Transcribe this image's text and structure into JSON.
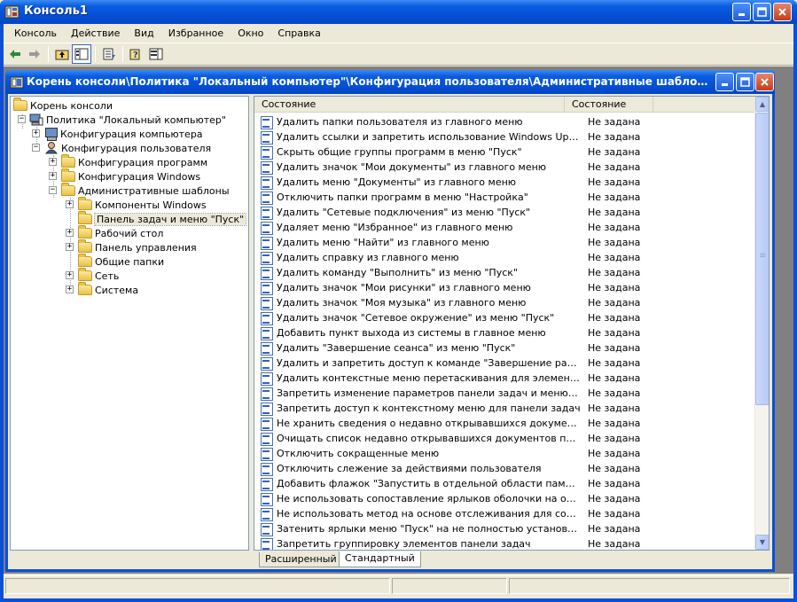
{
  "window": {
    "title": "Консоль1"
  },
  "menu": [
    "Консоль",
    "Действие",
    "Вид",
    "Избранное",
    "Окно",
    "Справка"
  ],
  "toolbar": {
    "icons": [
      "back-icon",
      "forward-icon",
      "up-folder-icon",
      "show-tree-icon",
      "export-list-icon",
      "help-icon",
      "show-action-pane-icon"
    ]
  },
  "inner_window": {
    "title": "Корень консоли\\Политика \"Локальный компьютер\"\\Конфигурация пользователя\\Административные шаблоны \\Панель задач и меню \"Пуск\""
  },
  "tree": {
    "items": [
      {
        "label": "Корень консоли"
      },
      {
        "label": "Политика \"Локальный компьютер\""
      },
      {
        "label": "Конфигурация компьютера"
      },
      {
        "label": "Конфигурация пользователя"
      },
      {
        "label": "Конфигурация программ"
      },
      {
        "label": "Конфигурация Windows"
      },
      {
        "label": "Административные шаблоны"
      },
      {
        "label": "Компоненты Windows"
      },
      {
        "label": "Панель задач и меню \"Пуск\""
      },
      {
        "label": "Рабочий стол"
      },
      {
        "label": "Панель управления"
      },
      {
        "label": "Общие папки"
      },
      {
        "label": "Сеть"
      },
      {
        "label": "Система"
      }
    ]
  },
  "list": {
    "columns": [
      "Состояние",
      "Состояние"
    ],
    "rows": [
      {
        "name": "Удалить папки пользователя из главного меню",
        "state": "Не задана"
      },
      {
        "name": "Удалить ссылки и запретить использование Windows Update",
        "state": "Не задана"
      },
      {
        "name": "Скрыть общие группы программ в меню \"Пуск\"",
        "state": "Не задана"
      },
      {
        "name": "Удалить значок \"Мои документы\" из главного меню",
        "state": "Не задана"
      },
      {
        "name": "Удалить меню \"Документы\" из главного меню",
        "state": "Не задана"
      },
      {
        "name": "Отключить папки программ в меню \"Настройка\"",
        "state": "Не задана"
      },
      {
        "name": "Удалить \"Сетевые подключения\" из меню \"Пуск\"",
        "state": "Не задана"
      },
      {
        "name": "Удаляет меню \"Избранное\" из главного меню",
        "state": "Не задана"
      },
      {
        "name": "Удалить меню \"Найти\" из главного меню",
        "state": "Не задана"
      },
      {
        "name": "Удалить справку из главного меню",
        "state": "Не задана"
      },
      {
        "name": "Удалить команду \"Выполнить\" из меню \"Пуск\"",
        "state": "Не задана"
      },
      {
        "name": "Удалить значок \"Мои рисунки\" из главного меню",
        "state": "Не задана"
      },
      {
        "name": "Удалить значок \"Моя музыка\" из главного меню",
        "state": "Не задана"
      },
      {
        "name": "Удалить значок \"Сетевое окружение\" из меню \"Пуск\"",
        "state": "Не задана"
      },
      {
        "name": "Добавить пункт выхода из системы в главное меню",
        "state": "Не задана"
      },
      {
        "name": "Удалить \"Завершение сеанса\" из меню \"Пуск\"",
        "state": "Не задана"
      },
      {
        "name": "Удалить и запретить доступ к команде \"Завершение работы\"",
        "state": "Не задана"
      },
      {
        "name": "Удалить контекстные меню перетаскивания для элементов ...",
        "state": "Не задана"
      },
      {
        "name": "Запретить изменение параметров панели задач и меню \"Пуск\"",
        "state": "Не задана"
      },
      {
        "name": "Запретить доступ к контекстному меню для панели задач",
        "state": "Не задана"
      },
      {
        "name": "Не хранить сведения о недавно открывавшихся документах",
        "state": "Не задана"
      },
      {
        "name": "Очищать список недавно открывавшихся документов при в...",
        "state": "Не задана"
      },
      {
        "name": "Отключить сокращенные меню",
        "state": "Не задана"
      },
      {
        "name": "Отключить слежение за действиями пользователя",
        "state": "Не задана"
      },
      {
        "name": "Добавить флажок \"Запустить в отдельной области памяти\" ...",
        "state": "Не задана"
      },
      {
        "name": "Не использовать сопоставление ярлыков оболочки на основ...",
        "state": "Не задана"
      },
      {
        "name": "Не использовать метод на основе отслеживания для сопоста...",
        "state": "Не задана"
      },
      {
        "name": "Затенить ярлыки меню \"Пуск\" на не полностью установленн...",
        "state": "Не задана"
      },
      {
        "name": "Запретить группировку элементов панели задач",
        "state": "Не задана"
      }
    ]
  },
  "tabs": [
    "Расширенный",
    "Стандартный"
  ],
  "active_tab": "Стандартный"
}
